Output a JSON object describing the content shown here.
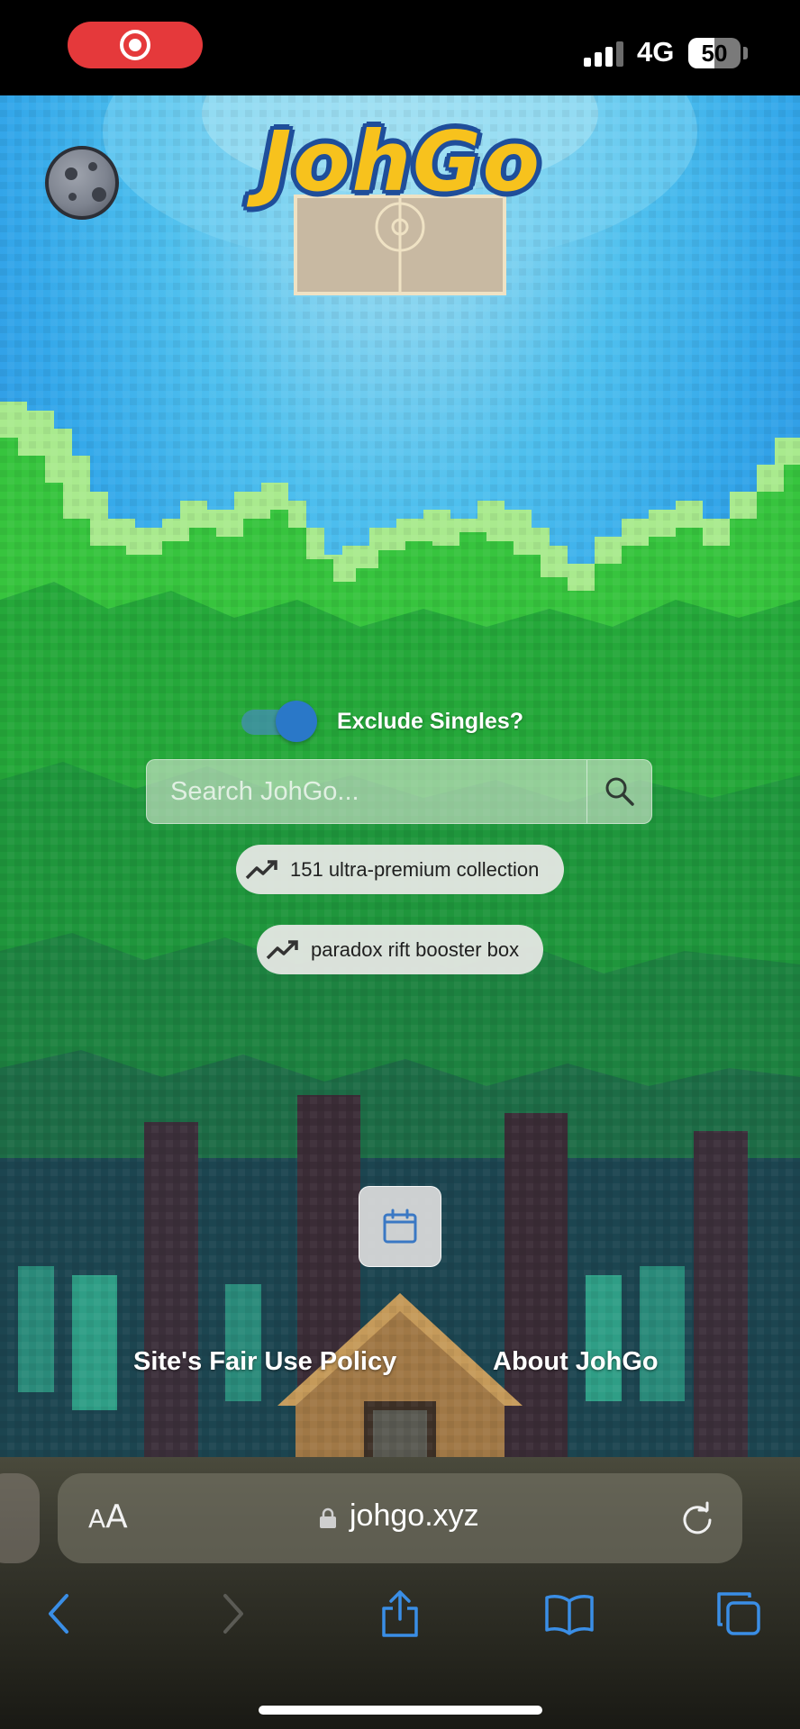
{
  "status_bar": {
    "network": "4G",
    "battery_percent": "50",
    "battery_level": 0.5
  },
  "header": {
    "logo_text": "JohGo",
    "theme_toggle_icon": "moon-icon"
  },
  "search": {
    "toggle_label": "Exclude Singles?",
    "toggle_on": true,
    "placeholder": "Search JohGo...",
    "search_icon": "search-icon"
  },
  "trending": [
    {
      "icon": "trending-up-icon",
      "label": "151 ultra-premium collection"
    },
    {
      "icon": "trending-up-icon",
      "label": "paradox rift booster box"
    }
  ],
  "calendar_button": {
    "icon": "calendar-icon"
  },
  "footer": {
    "fair_use_link": "Site's Fair Use Policy",
    "about_link": "About JohGo"
  },
  "browser": {
    "text_size_label_small": "A",
    "text_size_label_big": "A",
    "domain": "johgo.xyz"
  },
  "colors": {
    "accent_blue": "#2a78c8",
    "logo_yellow": "#f7c21d",
    "logo_outline": "#1f4e9a",
    "ios_blue": "#3a8ee6",
    "record_red": "#e5393b"
  }
}
